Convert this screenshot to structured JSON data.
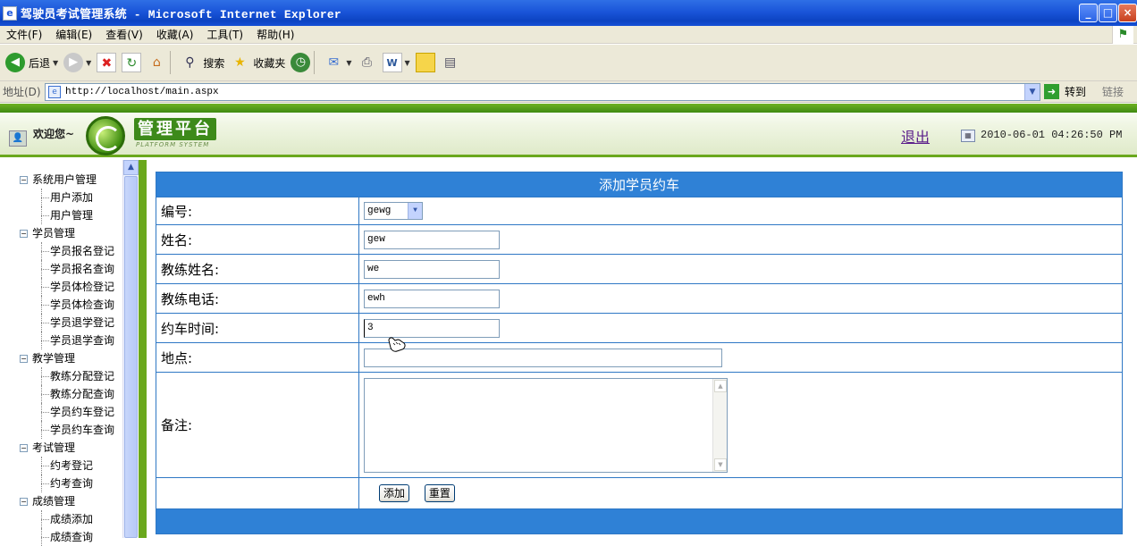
{
  "window": {
    "title": "驾驶员考试管理系统 - Microsoft Internet Explorer",
    "buttons": {
      "minimize": "_",
      "maximize": "□",
      "close": "×"
    }
  },
  "menu": [
    "文件(F)",
    "编辑(E)",
    "查看(V)",
    "收藏(A)",
    "工具(T)",
    "帮助(H)"
  ],
  "toolbar": {
    "back": "后退",
    "search": "搜索",
    "favorites": "收藏夹"
  },
  "address": {
    "label": "地址(D)",
    "url": "http://localhost/main.aspx",
    "go": "转到",
    "links": "链接"
  },
  "header": {
    "welcome": "欢迎您~",
    "logo_text": "管理平台",
    "logo_sub": "PLATFORM SYSTEM",
    "logout": "退出",
    "datetime": "2010-06-01 04:26:50 PM"
  },
  "sidebar": {
    "groups": [
      {
        "label": "系统用户管理",
        "items": [
          "用户添加",
          "用户管理"
        ]
      },
      {
        "label": "学员管理",
        "items": [
          "学员报名登记",
          "学员报名查询",
          "学员体检登记",
          "学员体检查询",
          "学员退学登记",
          "学员退学查询"
        ]
      },
      {
        "label": "教学管理",
        "items": [
          "教练分配登记",
          "教练分配查询",
          "学员约车登记",
          "学员约车查询"
        ]
      },
      {
        "label": "考试管理",
        "items": [
          "约考登记",
          "约考查询"
        ]
      },
      {
        "label": "成绩管理",
        "items": [
          "成绩添加",
          "成绩查询"
        ]
      }
    ]
  },
  "form": {
    "title": "添加学员约车",
    "fields": {
      "id": {
        "label": "编号:",
        "value": "gewg"
      },
      "name": {
        "label": "姓名:",
        "value": "gew"
      },
      "coach_name": {
        "label": "教练姓名:",
        "value": "we"
      },
      "coach_phone": {
        "label": "教练电话:",
        "value": "ewh"
      },
      "time": {
        "label": "约车时间:",
        "value": "3"
      },
      "place": {
        "label": "地点:",
        "value": ""
      },
      "remark": {
        "label": "备注:",
        "value": ""
      }
    },
    "buttons": {
      "add": "添加",
      "reset": "重置"
    }
  },
  "colors": {
    "title_bar": "#1a55d9",
    "accent_green": "#6aa81d",
    "form_header": "#2f81d6",
    "form_border": "#2f78c5"
  }
}
